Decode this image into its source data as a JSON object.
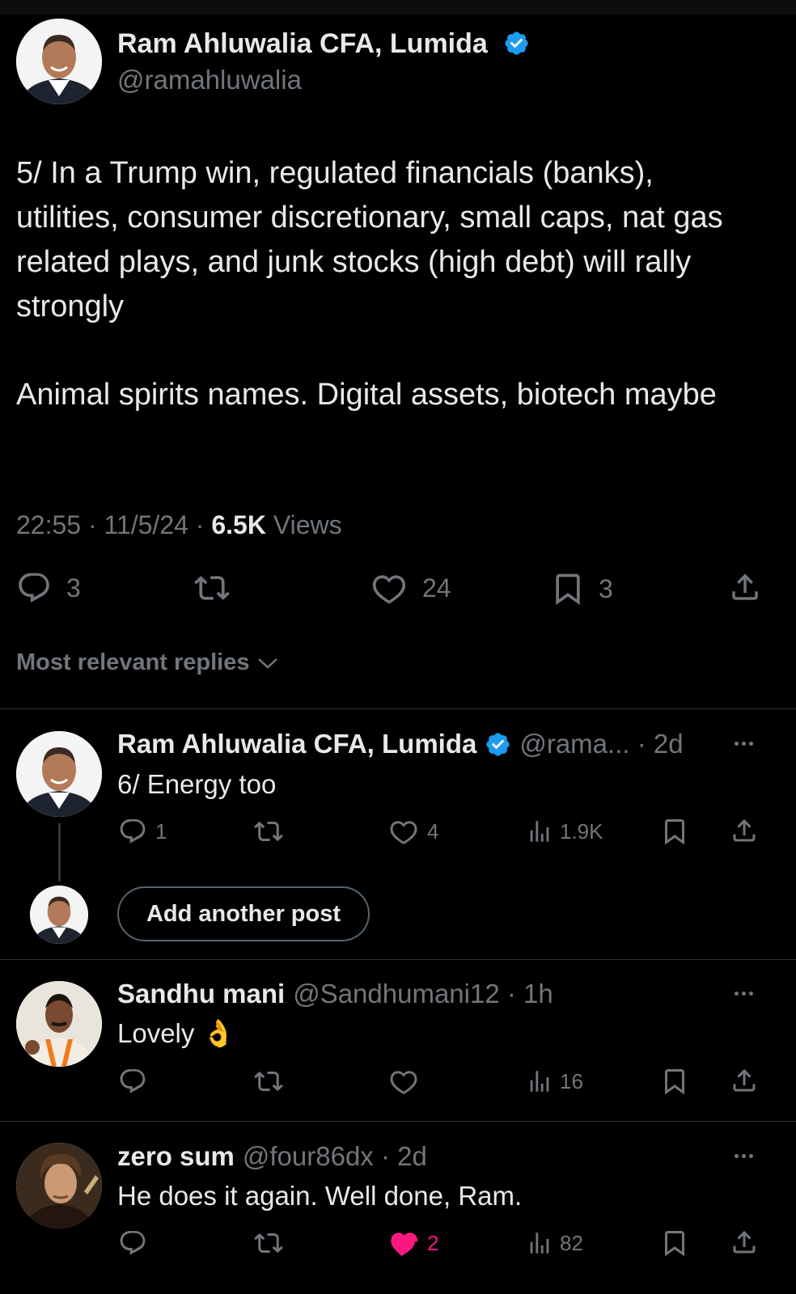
{
  "main_post": {
    "author_name": "Ram Ahluwalia CFA, Lumida",
    "author_handle": "@ramahluwalia",
    "text_paragraph_1": "5/ In a Trump win, regulated financials (banks), utilities, consumer discretionary, small caps, nat gas related plays, and junk stocks (high debt) will rally strongly",
    "text_paragraph_2": "Animal spirits names. Digital assets, biotech maybe",
    "time": "22:55",
    "date": "11/5/24",
    "views_count": "6.5K",
    "views_label": "Views",
    "separator": "·",
    "replies": "3",
    "likes": "24",
    "bookmarks": "3"
  },
  "sort": {
    "label": "Most relevant replies"
  },
  "replies": [
    {
      "author_name": "Ram Ahluwalia CFA, Lumida",
      "handle_time": "@rama... · 2d",
      "text": "6/ Energy too",
      "replies": "1",
      "likes": "4",
      "views": "1.9K"
    },
    {
      "author_name": "Sandhu mani",
      "handle_time": "@Sandhumani12 · 1h",
      "text": "Lovely 👌",
      "views": "16"
    },
    {
      "author_name": "zero sum",
      "handle_time": "@four86dx · 2d",
      "text": "He does it again. Well done, Ram.",
      "likes": "2",
      "views": "82"
    }
  ],
  "add_post": {
    "label": "Add another post"
  },
  "colors": {
    "background": "#000000",
    "text": "#e7e9ea",
    "muted": "#71767b",
    "verified": "#1d9bf0",
    "like_active": "#f91880"
  }
}
